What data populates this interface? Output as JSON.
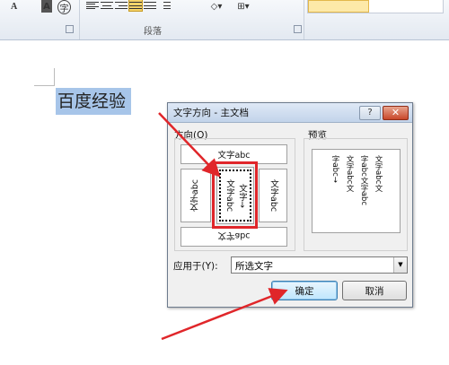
{
  "ribbon": {
    "font_color_label": "A",
    "char_shade_label": "A",
    "enclose_char_label": "字",
    "paragraph_group_label": "段落"
  },
  "document": {
    "selected_text": "百度经验"
  },
  "dialog": {
    "title": "文字方向 - 主文档",
    "help_label": "?",
    "close_label": "✕",
    "orientation_label": "方向(O)",
    "preview_label": "预览",
    "options": {
      "horizontal": "文字abc",
      "vertical_left_a": "文字abc",
      "vertical_left_b": "文字abc",
      "vertical_right": "文字abc",
      "vertical_selected_col1": "文字abc",
      "vertical_selected_col2": "文字→",
      "bottom": "文字abc"
    },
    "preview_columns": [
      "文字abc文",
      "字abc文字abc",
      "文字abc文",
      "字abc→"
    ],
    "apply_to_label": "应用于(Y):",
    "apply_to_value": "所选文字",
    "ok_label": "确定",
    "cancel_label": "取消"
  },
  "colors": {
    "annotation_red": "#e0262a",
    "selection_highlight": "#a7c5e9"
  }
}
